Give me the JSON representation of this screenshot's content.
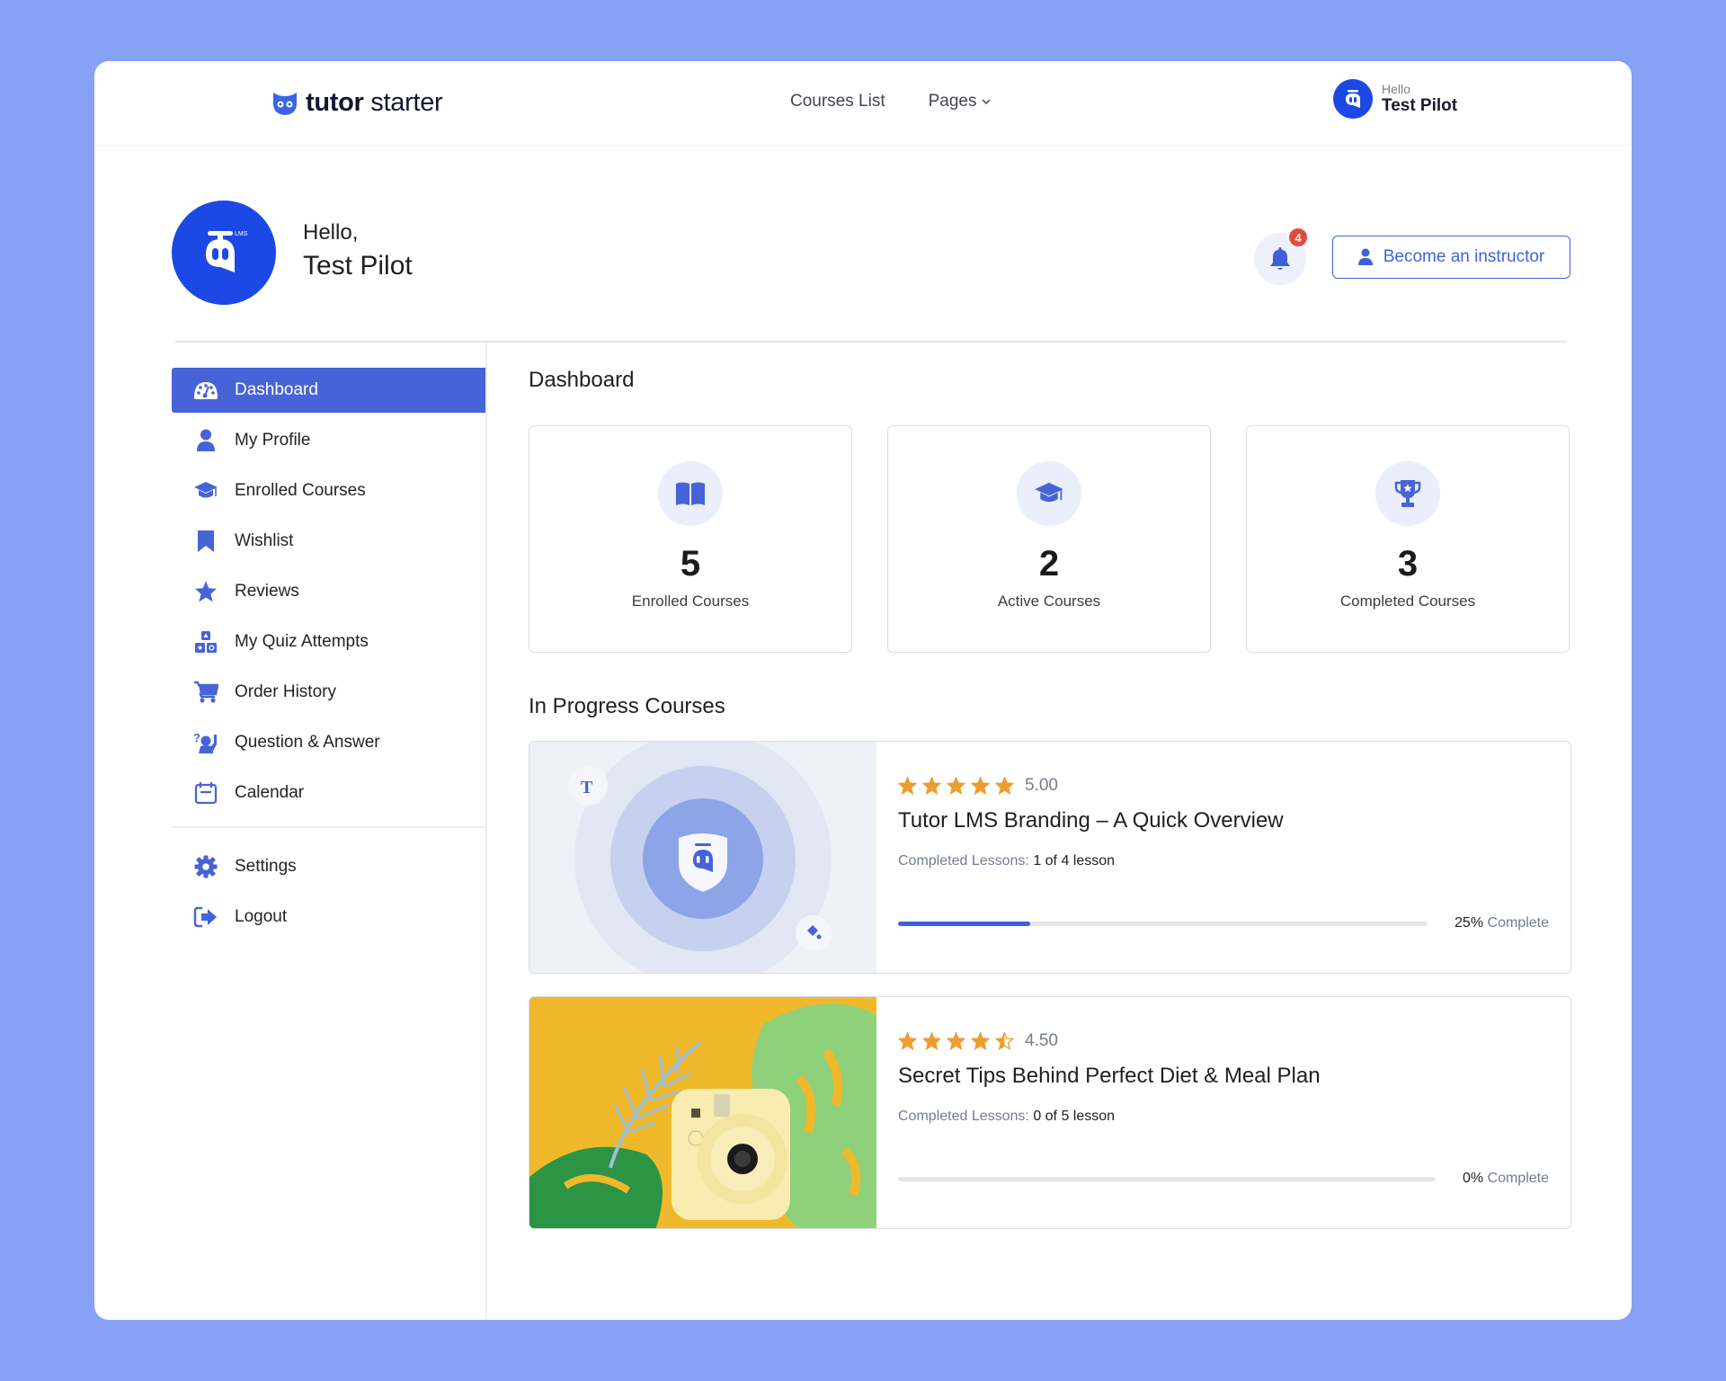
{
  "brand": {
    "name_bold": "tutor",
    "name_light": " starter"
  },
  "nav": {
    "items": [
      {
        "label": "Courses List"
      },
      {
        "label": "Pages"
      }
    ]
  },
  "top_user": {
    "greeting": "Hello",
    "name": "Test Pilot"
  },
  "profile": {
    "greeting": "Hello,",
    "name": "Test Pilot",
    "avatar_label": "LMS"
  },
  "notifications": {
    "count": "4"
  },
  "actions": {
    "become_instructor": "Become an instructor"
  },
  "sidebar": {
    "items": [
      {
        "label": "Dashboard",
        "icon": "dashboard-icon",
        "active": true
      },
      {
        "label": "My Profile",
        "icon": "user-icon"
      },
      {
        "label": "Enrolled Courses",
        "icon": "graduation-cap-icon"
      },
      {
        "label": "Wishlist",
        "icon": "bookmark-icon"
      },
      {
        "label": "Reviews",
        "icon": "star-icon"
      },
      {
        "label": "My Quiz Attempts",
        "icon": "quiz-blocks-icon"
      },
      {
        "label": "Order History",
        "icon": "cart-icon"
      },
      {
        "label": "Question & Answer",
        "icon": "question-answer-icon"
      },
      {
        "label": "Calendar",
        "icon": "calendar-icon"
      }
    ],
    "bottom_items": [
      {
        "label": "Settings",
        "icon": "gear-icon"
      },
      {
        "label": "Logout",
        "icon": "logout-icon"
      }
    ]
  },
  "main": {
    "title": "Dashboard",
    "stats": [
      {
        "value": "5",
        "label": "Enrolled Courses",
        "icon": "book-icon"
      },
      {
        "value": "2",
        "label": "Active Courses",
        "icon": "graduation-cap-icon"
      },
      {
        "value": "3",
        "label": "Completed Courses",
        "icon": "trophy-icon"
      }
    ],
    "in_progress_title": "In Progress Courses",
    "courses": [
      {
        "rating": "5.00",
        "rating_value": 5.0,
        "title": "Tutor LMS Branding – A Quick Overview",
        "lessons_label": "Completed Lessons:",
        "lessons_value": "1 of 4 lesson",
        "progress_percent": 25,
        "progress_text": "25%",
        "complete_label": "Complete"
      },
      {
        "rating": "4.50",
        "rating_value": 4.5,
        "title": "Secret Tips Behind Perfect Diet & Meal Plan",
        "lessons_label": "Completed Lessons:",
        "lessons_value": "0 of 5 lesson",
        "progress_percent": 0,
        "progress_text": "0%",
        "complete_label": "Complete"
      }
    ]
  },
  "colors": {
    "accent": "#4763d8",
    "brand_blue": "#1c49e5",
    "star": "#ed9c2f",
    "badge": "#e54b3c",
    "background": "#86a1f6"
  }
}
